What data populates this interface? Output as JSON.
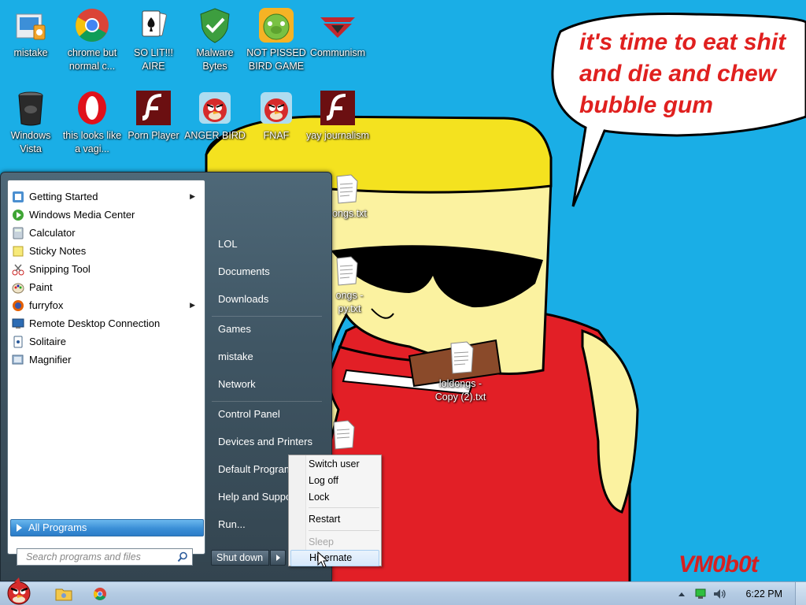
{
  "desktop": {
    "icons": [
      {
        "label": "mistake",
        "icon": "folder-media-icon"
      },
      {
        "label": "chrome but normal c...",
        "icon": "chrome-icon"
      },
      {
        "label": "SO LIT!!! AIRE",
        "icon": "solitaire-icon"
      },
      {
        "label": "Malware Bytes",
        "icon": "shield-check-icon"
      },
      {
        "label": "NOT PISSED BIRD GAME",
        "icon": "green-pig-icon"
      },
      {
        "label": "Communism",
        "icon": "emblem-icon"
      },
      {
        "label": "Windows Vista",
        "icon": "recycle-bin-icon"
      },
      {
        "label": "this looks like a vagi...",
        "icon": "opera-icon"
      },
      {
        "label": "Porn Player",
        "icon": "flash-icon"
      },
      {
        "label": "ANGER BIRD",
        "icon": "angry-bird-icon"
      },
      {
        "label": "FNAF",
        "icon": "angry-bird-icon"
      },
      {
        "label": "yay journalism",
        "icon": "flash-icon"
      }
    ],
    "files": [
      {
        "label": "ongs.txt"
      },
      {
        "label": "ongs - py.txt"
      },
      {
        "label": "loldongs - Copy (2).txt"
      }
    ],
    "wallpaper_caption": "it's time to eat shit and die and chew bubble gum",
    "signature": "VM0b0t"
  },
  "start_menu": {
    "programs": [
      {
        "label": "Getting Started",
        "icon": "getting-started-icon",
        "has_submenu": true
      },
      {
        "label": "Windows Media Center",
        "icon": "media-center-icon",
        "has_submenu": false
      },
      {
        "label": "Calculator",
        "icon": "calculator-icon",
        "has_submenu": false
      },
      {
        "label": "Sticky Notes",
        "icon": "sticky-notes-icon",
        "has_submenu": false
      },
      {
        "label": "Snipping Tool",
        "icon": "scissors-icon",
        "has_submenu": false
      },
      {
        "label": "Paint",
        "icon": "paint-icon",
        "has_submenu": false
      },
      {
        "label": "furryfox",
        "icon": "firefox-icon",
        "has_submenu": true
      },
      {
        "label": "Remote Desktop Connection",
        "icon": "remote-desktop-icon",
        "has_submenu": false
      },
      {
        "label": "Solitaire",
        "icon": "cards-icon",
        "has_submenu": false
      },
      {
        "label": "Magnifier",
        "icon": "magnifier-icon",
        "has_submenu": false
      }
    ],
    "all_programs_label": "All Programs",
    "search_placeholder": "Search programs and files",
    "right_items": [
      "LOL",
      "Documents",
      "Downloads",
      "Games",
      "mistake",
      "Network",
      "Control Panel",
      "Devices and Printers",
      "Default Programs",
      "Help and Support",
      "Run..."
    ],
    "shutdown_label": "Shut down"
  },
  "shutdown_menu": {
    "items": [
      {
        "label": "Switch user",
        "enabled": true
      },
      {
        "label": "Log off",
        "enabled": true
      },
      {
        "label": "Lock",
        "enabled": true
      },
      {
        "label": "Restart",
        "enabled": true
      },
      {
        "label": "Sleep",
        "enabled": false
      },
      {
        "label": "Hibernate",
        "enabled": true,
        "hovered": true
      }
    ]
  },
  "taskbar": {
    "pinned": [
      "angry-bird-start-icon",
      "explorer-icon",
      "chrome-icon"
    ],
    "tray_icons": [
      "show-hidden-icon",
      "network-icon",
      "volume-icon"
    ],
    "clock": "6:22 PM"
  },
  "colors": {
    "wallpaper_sky": "#1aaee6",
    "hover_blue": "#3a8ed6"
  }
}
